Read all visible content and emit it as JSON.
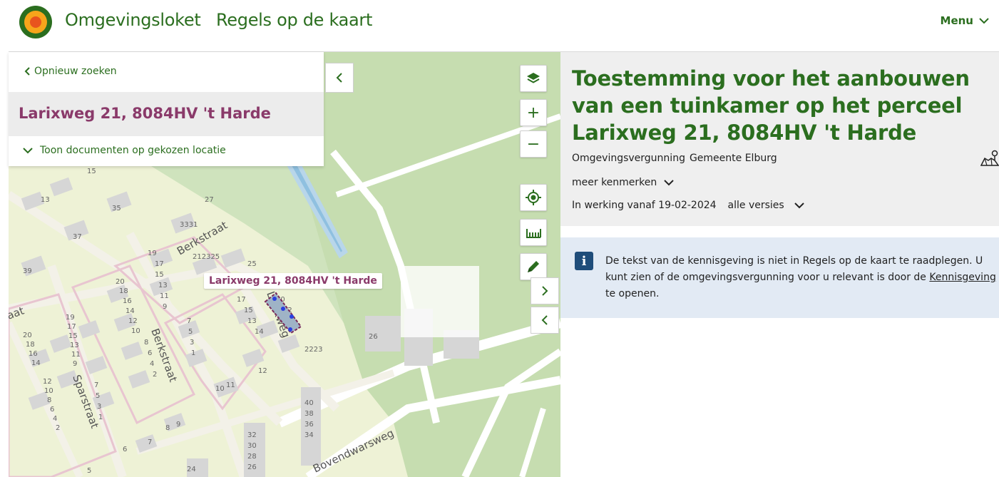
{
  "header": {
    "brand_part1": "Omgevings",
    "brand_part2": "loket",
    "app_title": "Regels op de kaart",
    "menu_label": "Menu"
  },
  "search_panel": {
    "back_label": "Opnieuw zoeken",
    "location": "Larixweg 21, 8084HV 't Harde",
    "toggle_label": "Toon documenten op gekozen locatie"
  },
  "map": {
    "marker_label": "Larixweg 21, 8084HV 't Harde",
    "streets": [
      "Berkstraat",
      "Berkstraat",
      "Sparstraat",
      "Larixweg",
      "Bovendwarsweg"
    ],
    "house_numbers": [
      "15",
      "13",
      "35",
      "37",
      "39",
      "33",
      "31",
      "27",
      "21",
      "23",
      "25",
      "19",
      "17",
      "15",
      "13",
      "11",
      "9",
      "20",
      "18",
      "16",
      "14",
      "12",
      "10",
      "7",
      "5",
      "3",
      "1",
      "8",
      "6",
      "4",
      "2",
      "19",
      "17",
      "15",
      "13",
      "11",
      "9",
      "7",
      "5",
      "3",
      "1",
      "20",
      "18",
      "16",
      "14",
      "12",
      "10",
      "8",
      "6",
      "4",
      "2",
      "17",
      "15",
      "13",
      "14",
      "20",
      "22",
      "23",
      "12",
      "26",
      "11",
      "10",
      "9",
      "8",
      "7",
      "6",
      "5",
      "40",
      "38",
      "36",
      "34",
      "32",
      "30",
      "28",
      "26",
      "24"
    ]
  },
  "controls": {
    "layers": "layers-icon",
    "zoom_in": "+",
    "zoom_out": "−",
    "locate": "locate-icon",
    "measure": "ruler-icon",
    "draw": "pencil-icon"
  },
  "detail": {
    "title": "Toestemming voor het aanbouwen van een tuinkamer op het perceel Larixweg 21, 8084HV 't Harde",
    "type": "Omgevingsvergunning",
    "authority": "Gemeente Elburg",
    "more_label": "meer kenmerken",
    "effective": "In werking vanaf 19-02-2024",
    "versions_label": "alle versies",
    "notice_pre": "De tekst van de kennisgeving is niet in Regels op de kaart te raadplegen. U kunt zien of de omgevingsvergunning voor u relevant is door de ",
    "notice_link": "Kennisgeving",
    "notice_post": " te openen."
  },
  "colors": {
    "brand_green": "#2b6e1f",
    "location_purple": "#8a3a6a",
    "notice_bg": "#e2eaf4",
    "map_green": "#d8ebc8"
  }
}
